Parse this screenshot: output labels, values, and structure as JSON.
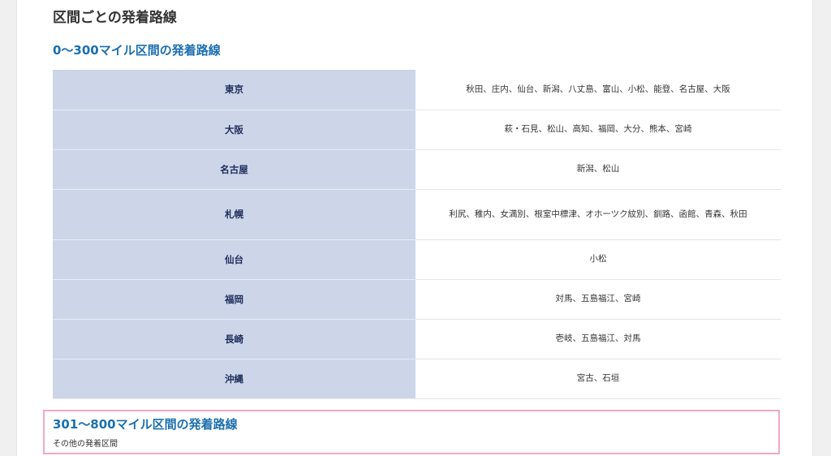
{
  "page": {
    "title": "区間ごとの発着路線"
  },
  "section1": {
    "title": "0〜300マイル区間の発着路線",
    "rows": [
      {
        "origin": "東京",
        "destinations": "秋田、庄内、仙台、新潟、八丈島、富山、小松、能登、名古屋、大阪"
      },
      {
        "origin": "大阪",
        "destinations": "萩・石見、松山、高知、福岡、大分、熊本、宮崎"
      },
      {
        "origin": "名古屋",
        "destinations": "新潟、松山"
      },
      {
        "origin": "札幌",
        "destinations": "利尻、稚内、女満別、根室中標津、オホーツク紋別、釧路、函館、青森、秋田"
      },
      {
        "origin": "仙台",
        "destinations": "小松"
      },
      {
        "origin": "福岡",
        "destinations": "対馬、五島福江、宮崎"
      },
      {
        "origin": "長崎",
        "destinations": "壱岐、五島福江、対馬"
      },
      {
        "origin": "沖縄",
        "destinations": "宮古、石垣"
      }
    ]
  },
  "section2": {
    "title": "301〜800マイル区間の発着路線",
    "subtitle": "その他の発着区間"
  }
}
